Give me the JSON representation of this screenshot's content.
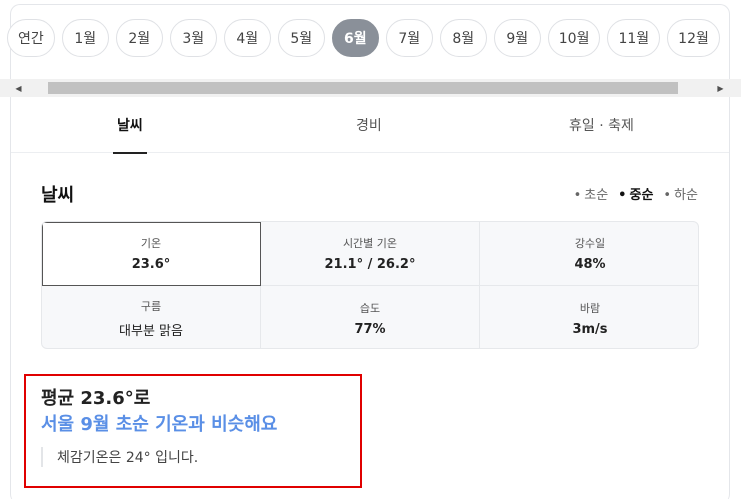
{
  "months": [
    "연간",
    "1월",
    "2월",
    "3월",
    "4월",
    "5월",
    "6월",
    "7월",
    "8월",
    "9월",
    "10월",
    "11월",
    "12월"
  ],
  "active_month_index": 6,
  "tabs": [
    "날씨",
    "경비",
    "휴일 · 축제"
  ],
  "section": {
    "title": "날씨",
    "periods": [
      "초순",
      "중순",
      "하순"
    ],
    "active_period_index": 1
  },
  "stats": {
    "temp": {
      "label": "기온",
      "value": "23.6°"
    },
    "hourly": {
      "label": "시간별 기온",
      "value": "21.1° / 26.2°"
    },
    "precip": {
      "label": "강수일",
      "value": "48%"
    },
    "cloud": {
      "label": "구름",
      "value": "대부분 맑음"
    },
    "humidity": {
      "label": "습도",
      "value": "77%"
    },
    "wind": {
      "label": "바람",
      "value": "3m/s"
    }
  },
  "summary": {
    "line1": "평균 23.6°로",
    "line2": "서울 9월 초순 기온과 비슷해요",
    "note": "체감기온은 24° 입니다."
  }
}
